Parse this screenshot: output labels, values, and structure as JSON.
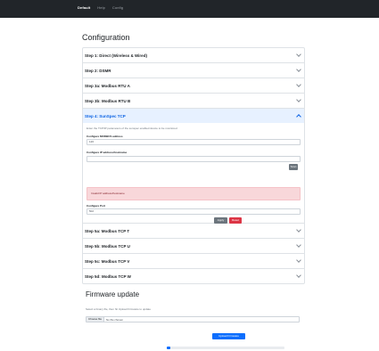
{
  "nav": {
    "items": [
      "Default",
      "Help",
      "Config"
    ],
    "active_index": 0
  },
  "page": {
    "title": "Configuration"
  },
  "steps": [
    {
      "label": "Step 1: Direct (Wireless & Wired)",
      "expanded": false
    },
    {
      "label": "Step 2: DSMR",
      "expanded": false
    },
    {
      "label": "Step 3a: Modbus RTU A",
      "expanded": false
    },
    {
      "label": "Step 3b: Modbus RTU B",
      "expanded": false
    },
    {
      "label": "Step 4: SunSpec TCP",
      "expanded": true
    },
    {
      "label": "Step 5a: Modbus TCP T",
      "expanded": false
    },
    {
      "label": "Step 5b: Modbus TCP U",
      "expanded": false
    },
    {
      "label": "Step 5c: Modbus TCP V",
      "expanded": false
    },
    {
      "label": "Step 5d: Modbus TCP W",
      "expanded": false
    }
  ],
  "sunspec": {
    "help": "Enter the TCP/IP parameters of the sunspec enabled device to be monitored",
    "modbus_address_label": "Configure MODBUS address",
    "modbus_address_value": "126",
    "ip_label": "Configure IP address/hostname",
    "ip_value": "",
    "lookup_button": "Scan",
    "alert_text": "Invalid IP address/hostname",
    "port_label": "Configure Port",
    "port_value": "502",
    "apply_button": "Apply",
    "reset_button": "Reset"
  },
  "firmware": {
    "title": "Firmware update",
    "help": "Select a binary file, then hit Upload Firmware to update",
    "choose_file": "Choose file",
    "no_file": "No file chosen",
    "upload_button": "Upload Firmware",
    "progress": 0.03
  },
  "colors": {
    "topbar": "#212529",
    "accordion_open_bg": "#e7f1ff",
    "accent": "#0d6efd",
    "danger": "#dc3545",
    "alert_bg": "#f8d7da"
  }
}
